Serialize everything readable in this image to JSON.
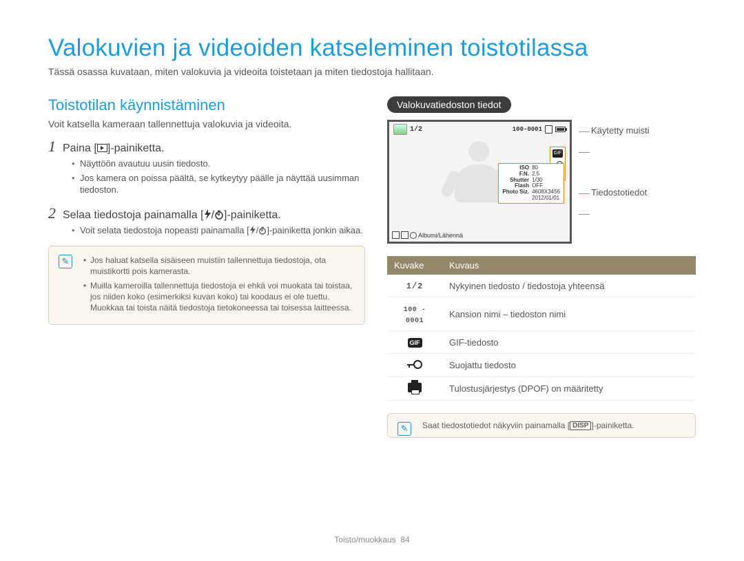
{
  "title": "Valokuvien ja videoiden katseleminen toistotilassa",
  "intro": "Tässä osassa kuvataan, miten valokuvia ja videoita toistetaan ja miten tiedostoja hallitaan.",
  "left": {
    "heading": "Toistotilan käynnistäminen",
    "sub": "Voit katsella kameraan tallennettuja valokuvia ja videoita.",
    "step1_pre": "Paina [",
    "step1_post": "]-painiketta.",
    "step1_bullets": [
      "Näyttöön avautuu uusin tiedosto.",
      "Jos kamera on poissa päältä, se kytkeytyy päälle ja näyttää uusimman tiedoston."
    ],
    "step2_pre": "Selaa tiedostoja painamalla [",
    "step2_post": "]-painiketta.",
    "step2_bullets_pre": "Voit selata tiedostoja nopeasti painamalla [",
    "step2_bullets_post": "]-painiketta jonkin aikaa.",
    "note1": "Jos haluat katsella sisäiseen muistiin tallennettuja tiedostoja, ota muistikortti pois kamerasta.",
    "note2": "Muilla kameroilla tallennettuja tiedostoja ei ehkä voi muokata tai toistaa, jos niiden koko (esimerkiksi kuvan koko) tai koodaus ei ole tuettu. Muokkaa tai toista näitä tiedostoja tietokoneessa tai toisessa laitteessa."
  },
  "right": {
    "pill": "Valokuvatiedoston tiedot",
    "lcd": {
      "top_count": "1/2",
      "top_folder": "100-0001",
      "bottom": "Albumi/Lähennä",
      "info_rows": [
        [
          "ISO",
          "80"
        ],
        [
          "F.N.",
          "2.5"
        ],
        [
          "Shutter",
          "1/30"
        ],
        [
          "Flash",
          "OFF"
        ],
        [
          "Photo Siz.",
          "4608X3456"
        ],
        [
          "",
          "2012/01/01"
        ]
      ]
    },
    "callout_mem": "Käytetty muisti",
    "callout_info": "Tiedostotiedot",
    "table": {
      "h1": "Kuvake",
      "h2": "Kuvaus",
      "rows": [
        {
          "desc": "Nykyinen tiedosto / tiedostoja yhteensä"
        },
        {
          "desc": "Kansion nimi – tiedoston nimi"
        },
        {
          "desc": "GIF-tiedosto"
        },
        {
          "desc": "Suojattu tiedosto"
        },
        {
          "desc": "Tulostusjärjestys (DPOF) on määritetty"
        }
      ],
      "icon_12": "1/2",
      "icon_folder": "100 - 0001",
      "icon_gif": "GIF"
    },
    "note_pre": "Saat tiedostotiedot näkyviin painamalla [",
    "note_disp": "DISP",
    "note_post": "]-painiketta."
  },
  "footer_section": "Toisto/muokkaus",
  "footer_page": "84"
}
